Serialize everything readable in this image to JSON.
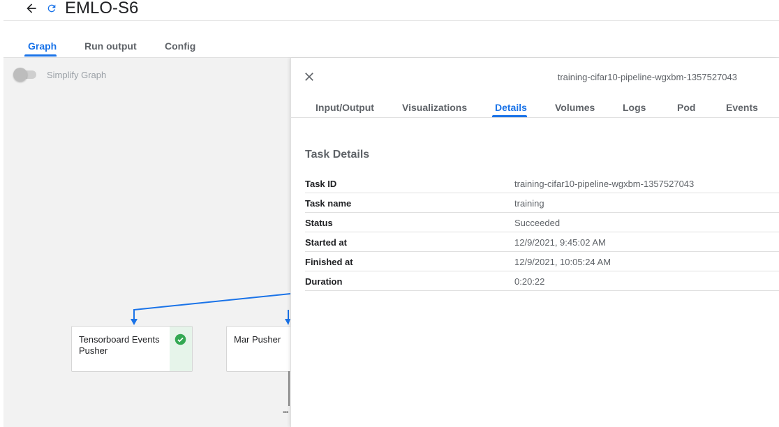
{
  "header": {
    "title": "EMLO-S6",
    "back_icon": "arrow-back-icon",
    "status_icon": "refresh-status-icon",
    "accent_color": "#1a73e8"
  },
  "top_tabs": [
    {
      "label": "Graph",
      "active": true
    },
    {
      "label": "Run output",
      "active": false
    },
    {
      "label": "Config",
      "active": false
    }
  ],
  "graph": {
    "simplify_label": "Simplify Graph",
    "simplify_enabled": false,
    "nodes": [
      {
        "label": "Tensorboard Events Pusher",
        "status": "succeeded",
        "status_color": "#34a853"
      },
      {
        "label": "Mar Pusher",
        "status": "",
        "status_color": ""
      }
    ]
  },
  "panel": {
    "title": "training-cifar10-pipeline-wgxbm-1357527043",
    "close_icon": "close-icon",
    "tabs": [
      {
        "label": "Input/Output",
        "active": false
      },
      {
        "label": "Visualizations",
        "active": false
      },
      {
        "label": "Details",
        "active": true
      },
      {
        "label": "Volumes",
        "active": false
      },
      {
        "label": "Logs",
        "active": false
      },
      {
        "label": "Pod",
        "active": false
      },
      {
        "label": "Events",
        "active": false
      }
    ],
    "section_title": "Task Details",
    "details": [
      {
        "key": "Task ID",
        "value": "training-cifar10-pipeline-wgxbm-1357527043"
      },
      {
        "key": "Task name",
        "value": "training"
      },
      {
        "key": "Status",
        "value": "Succeeded"
      },
      {
        "key": "Started at",
        "value": "12/9/2021, 9:45:02 AM"
      },
      {
        "key": "Finished at",
        "value": "12/9/2021, 10:05:24 AM"
      },
      {
        "key": "Duration",
        "value": "0:20:22"
      }
    ]
  }
}
